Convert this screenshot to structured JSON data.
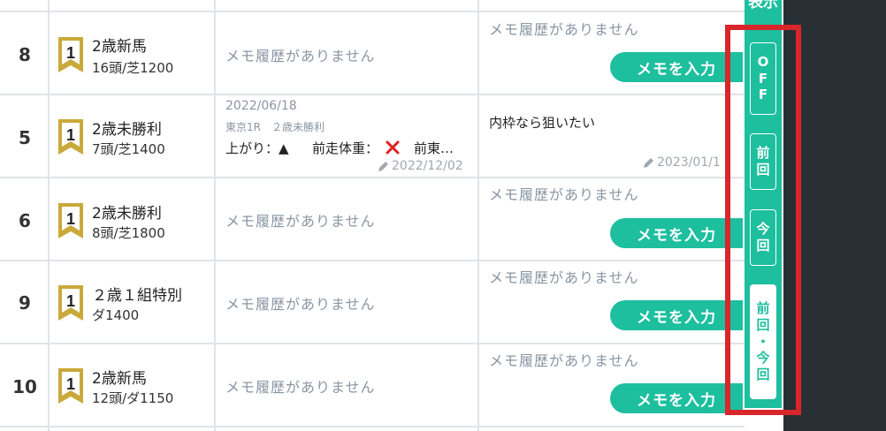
{
  "rows": [
    {
      "num": "8",
      "rank": "1",
      "race": "2歳新馬",
      "detail": "16頭/芝1200",
      "prev_memo": "メモ履歴がありません",
      "curr_memo": "メモ履歴がありません",
      "btn": "メモを入力"
    },
    {
      "num": "5",
      "rank": "1",
      "race": "2歳未勝利",
      "detail": "7頭/芝1400",
      "prev_date": "2022/06/18",
      "prev_race": "東京1R　２歳未勝利",
      "prev_eval_up": "上がり：▲",
      "prev_eval_weight": "前走体重：",
      "prev_eval_more": "前東…",
      "prev_memo_date": "2022/12/02",
      "curr_text": "内枠なら狙いたい",
      "curr_memo_date": "2023/01/1"
    },
    {
      "num": "6",
      "rank": "1",
      "race": "2歳未勝利",
      "detail": "8頭/芝1800",
      "prev_memo": "メモ履歴がありません",
      "curr_memo": "メモ履歴がありません",
      "btn": "メモを入力"
    },
    {
      "num": "9",
      "rank": "1",
      "race": "２歳１組特別",
      "detail": "ダ1400",
      "prev_memo": "メモ履歴がありません",
      "curr_memo": "メモ履歴がありません",
      "btn": "メモを入力"
    },
    {
      "num": "10",
      "rank": "1",
      "race": "2歳新馬",
      "detail": "12頭/ダ1150",
      "prev_memo": "メモ履歴がありません",
      "curr_memo": "メモ履歴がありません",
      "btn": "メモを入力"
    }
  ],
  "side": {
    "label": "表示",
    "off": [
      "O",
      "F",
      "F"
    ],
    "prev": [
      "前",
      "回"
    ],
    "curr": [
      "今",
      "回"
    ],
    "both": [
      "前",
      "回",
      "・",
      "今",
      "回"
    ]
  },
  "colors": {
    "accent": "#1dbf9e",
    "highlight": "#d8262b",
    "dark": "#283035"
  }
}
